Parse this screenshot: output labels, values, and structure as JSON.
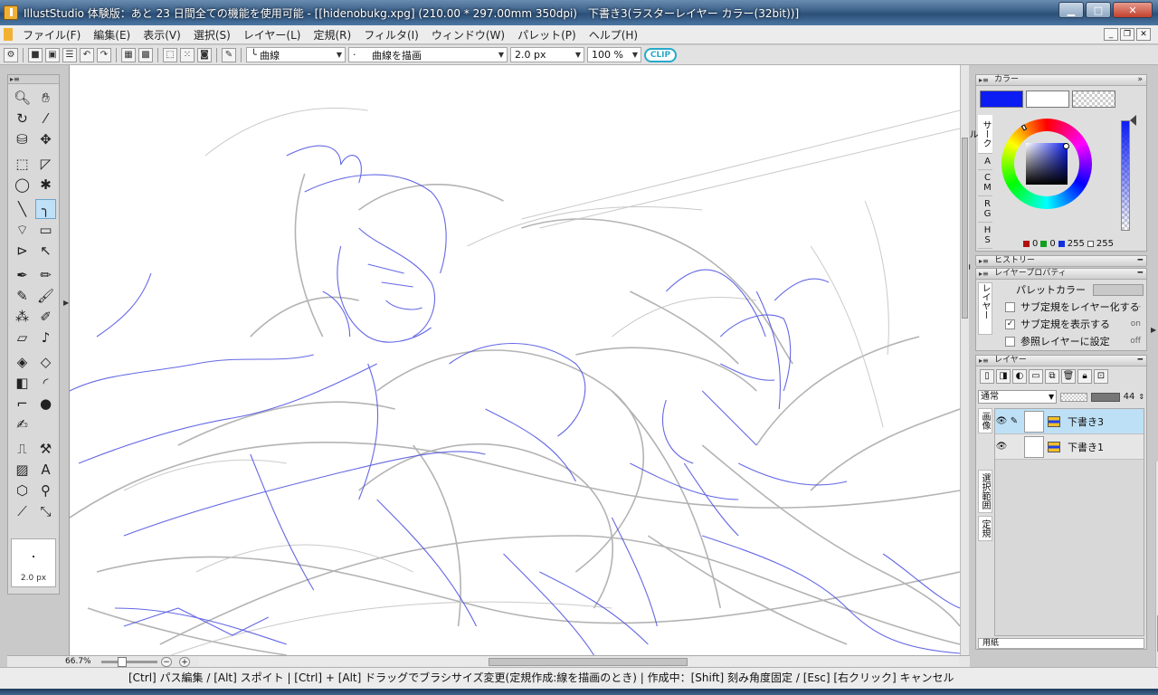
{
  "window": {
    "title": "IllustStudio 体験版：あと 23 日間全ての機能を使用可能 - [[hidenobukg.xpg] (210.00 * 297.00mm 350dpi)　下書き3(ラスターレイヤー カラー(32bit))]"
  },
  "menu": {
    "items": [
      "ファイル(F)",
      "編集(E)",
      "表示(V)",
      "選択(S)",
      "レイヤー(L)",
      "定規(R)",
      "フィルタ(I)",
      "ウィンドウ(W)",
      "パレット(P)",
      "ヘルプ(H)"
    ]
  },
  "options": {
    "curve_type": "曲線",
    "draw_mode": "曲線を描画",
    "brush_size": "2.0 px",
    "zoom": "100 %"
  },
  "toolbox": {
    "brush_preview_size": "2.0 px"
  },
  "canvas": {
    "zoom_display": "66.7%"
  },
  "status": {
    "hint": "[Ctrl] パス編集 / [Alt] スポイト | [Ctrl] + [Alt] ドラッグでブラシサイズ変更(定規作成:線を描画のとき) | 作成中：[Shift] 刻み角度固定 / [Esc] [右クリック] キャンセル"
  },
  "panels": {
    "color": {
      "title": "カラー",
      "tabs": [
        "サークル",
        "A",
        "CM",
        "RG",
        "HS"
      ],
      "values": {
        "r": "0",
        "g": "0",
        "b": "255",
        "a": "255"
      },
      "fg_color": "#0b1df2",
      "bg_color": "#ffffff"
    },
    "history": {
      "title": "ヒストリー"
    },
    "layer_property": {
      "title": "レイヤープロパティ",
      "tab": "レイヤー",
      "palette_color_label": "パレットカラー",
      "rows": [
        {
          "label": "サブ定規をレイヤー化する",
          "checked": false,
          "state": "-"
        },
        {
          "label": "サブ定規を表示する",
          "checked": true,
          "state": "on"
        },
        {
          "label": "参照レイヤーに設定",
          "checked": false,
          "state": "off"
        }
      ]
    },
    "layer": {
      "title": "レイヤー",
      "blend_mode": "通常",
      "opacity": "44",
      "tabs": [
        "画像",
        "選択範囲",
        "定規"
      ],
      "layers": [
        {
          "name": "下書き3",
          "selected": true
        },
        {
          "name": "下書き1",
          "selected": false
        }
      ],
      "footer": "用紙"
    }
  }
}
